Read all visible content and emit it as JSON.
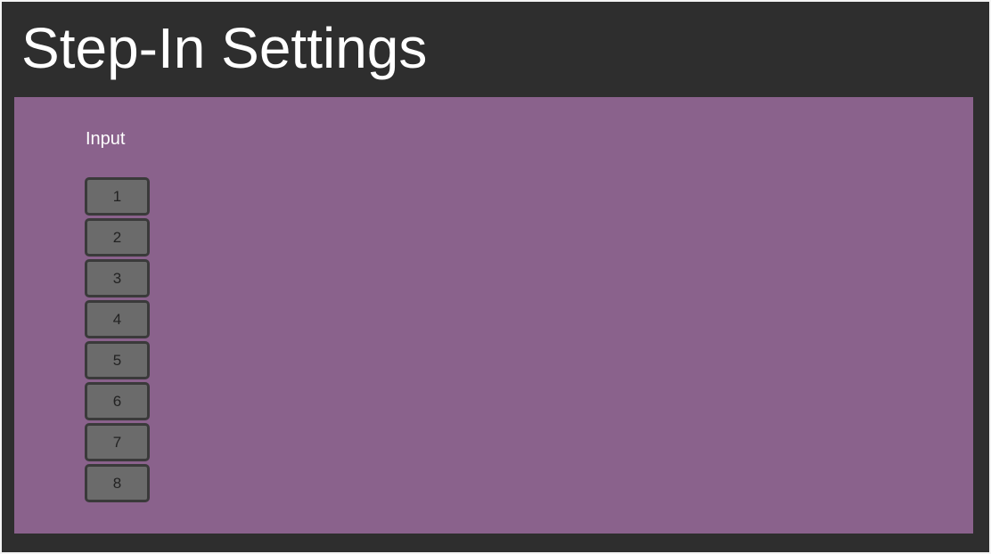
{
  "colors": {
    "frame_background": "#2e2e2e",
    "panel_background": "#8a628c",
    "button_background": "#6b6b6b",
    "button_border": "#3a3a3a",
    "title_text": "#ffffff"
  },
  "header": {
    "title": "Step-In Settings"
  },
  "panel": {
    "input_label": "Input",
    "inputs": [
      {
        "label": "1"
      },
      {
        "label": "2"
      },
      {
        "label": "3"
      },
      {
        "label": "4"
      },
      {
        "label": "5"
      },
      {
        "label": "6"
      },
      {
        "label": "7"
      },
      {
        "label": "8"
      }
    ]
  }
}
